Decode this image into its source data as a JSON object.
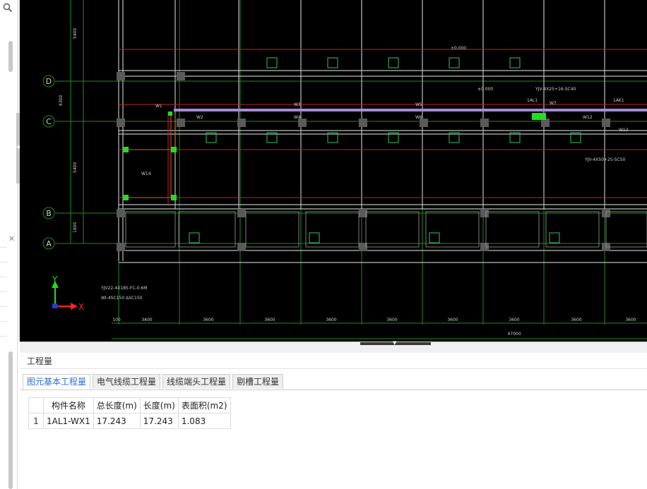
{
  "left_panel": {
    "close_glyph": "✕",
    "search_icon": "search-icon"
  },
  "drawing": {
    "grid_labels": [
      "D",
      "C",
      "B",
      "A"
    ],
    "left_dims": [
      "5400",
      "6300",
      "5400",
      "1800"
    ],
    "bottom_dims": [
      "100",
      "3400",
      "3600",
      "3600",
      "3600",
      "3600",
      "3600",
      "3600",
      "3600",
      "3600"
    ],
    "total_dim": "47000",
    "room_labels": [
      "W1",
      "W2",
      "W3",
      "W4",
      "W5",
      "W6",
      "W7",
      "W12",
      "W13",
      "W14"
    ],
    "panel_labels": [
      "1AL1",
      "1AK1"
    ],
    "elevation_labels": [
      "±0.000",
      "±0.000"
    ],
    "cable_notes": [
      "YJV22-4X185-FC-0.6M",
      "WI-4SC150 ΔSC150",
      "YJV-4X25+16-SC40",
      "YJV-4X50+25-SC50"
    ],
    "axis_y": "Y",
    "axis_x": "X"
  },
  "panel": {
    "title": "工程量",
    "tabs": [
      "图元基本工程量",
      "电气线缆工程量",
      "线缆端头工程量",
      "剔槽工程量"
    ],
    "active_tab": 0,
    "table": {
      "headers": [
        "构件名称",
        "总长度(m)",
        "长度(m)",
        "表面积(m2)"
      ],
      "rows": [
        {
          "index": "1",
          "cells": [
            "1AL1-WX1",
            "17.243",
            "17.243",
            "1.083"
          ]
        }
      ]
    }
  },
  "colors": {
    "canvas_bg": "#000000",
    "selected_line": "#a58ad6",
    "highlight": "#22dd22",
    "axis_x": "#ff2020",
    "axis_y": "#22dd22",
    "tab_active": "#2a6fd6"
  }
}
